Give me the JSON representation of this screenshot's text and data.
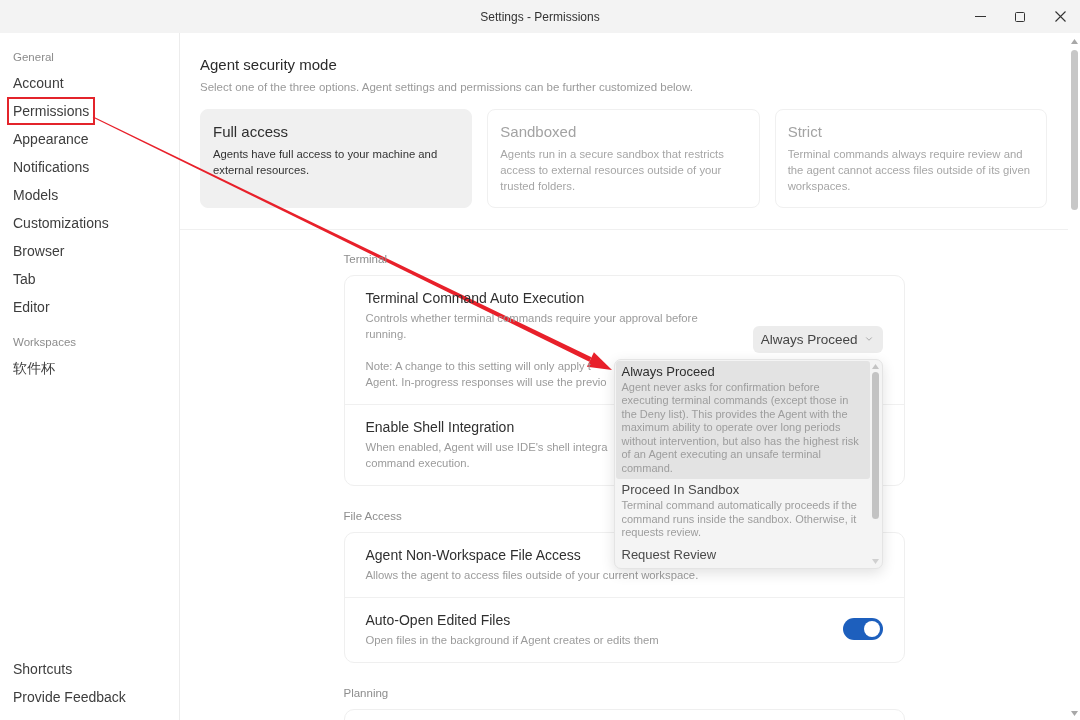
{
  "window": {
    "title": "Settings - Permissions"
  },
  "sidebar": {
    "sections": [
      {
        "heading": "General",
        "items": [
          {
            "label": "Account",
            "annotated": false
          },
          {
            "label": "Permissions",
            "annotated": true
          },
          {
            "label": "Appearance",
            "annotated": false
          },
          {
            "label": "Notifications",
            "annotated": false
          },
          {
            "label": "Models",
            "annotated": false
          },
          {
            "label": "Customizations",
            "annotated": false
          },
          {
            "label": "Browser",
            "annotated": false
          },
          {
            "label": "Tab",
            "annotated": false
          },
          {
            "label": "Editor",
            "annotated": false
          }
        ]
      },
      {
        "heading": "Workspaces",
        "items": [
          {
            "label": "软件杯",
            "annotated": false
          }
        ]
      }
    ],
    "footer_items": [
      "Shortcuts",
      "Provide Feedback"
    ]
  },
  "security_mode": {
    "title": "Agent security mode",
    "subtitle": "Select one of the three options. Agent settings and permissions can be further customized below.",
    "options": [
      {
        "name": "Full access",
        "description": "Agents have full access to your machine and external resources.",
        "selected": true
      },
      {
        "name": "Sandboxed",
        "description": "Agents run in a secure sandbox that restricts access to external resources outside of your trusted folders.",
        "selected": false
      },
      {
        "name": "Strict",
        "description": "Terminal commands always require review and the agent cannot access files outside of its given workspaces.",
        "selected": false
      }
    ]
  },
  "groups": [
    {
      "heading": "Terminal",
      "settings": [
        {
          "kind": "select",
          "title": "Terminal Command Auto Execution",
          "description": "Controls whether terminal commands require your approval before running.",
          "note_lines": [
            "Note: A change to this setting will only apply t",
            "Agent. In-progress responses will use the previo"
          ],
          "value": "Always Proceed",
          "menu_options": [
            {
              "label": "Always Proceed",
              "description": "Agent never asks for confirmation before executing terminal commands (except those in the Deny list). This provides the Agent with the maximum ability to operate over long periods without intervention, but also has the highest risk of an Agent executing an unsafe terminal command.",
              "selected": true
            },
            {
              "label": "Proceed In Sandbox",
              "description": "Terminal command automatically proceeds if the command runs inside the sandbox. Otherwise, it requests review.",
              "selected": false
            },
            {
              "label": "Request Review",
              "selected": false
            }
          ]
        },
        {
          "kind": "text",
          "title": "Enable Shell Integration",
          "description_lines": [
            "When enabled, Agent will use IDE's shell integra",
            "command execution."
          ]
        }
      ]
    },
    {
      "heading": "File Access",
      "settings": [
        {
          "kind": "text",
          "title": "Agent Non-Workspace File Access",
          "description": "Allows the agent to access files outside of your current workspace."
        },
        {
          "kind": "toggle",
          "title": "Auto-Open Edited Files",
          "description": "Open files in the background if Agent creates or edits them",
          "on": true
        }
      ]
    },
    {
      "heading": "Planning"
    }
  ],
  "annotation_arrow": true
}
